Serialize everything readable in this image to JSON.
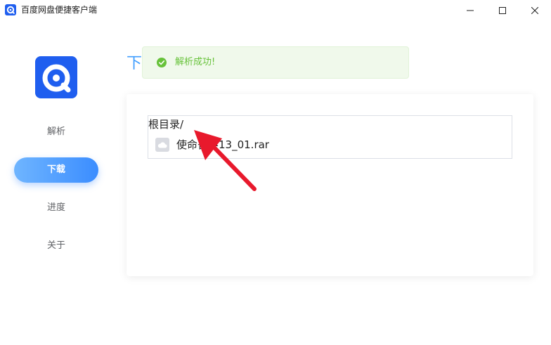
{
  "window": {
    "title": "百度网盘便捷客户端",
    "controls": {
      "minimize": "minimize",
      "maximize": "maximize",
      "close": "close"
    }
  },
  "sidebar": {
    "logo": "baidu-netdisk-logo",
    "items": [
      {
        "label": "解析",
        "active": false
      },
      {
        "label": "下载",
        "active": true
      },
      {
        "label": "进度",
        "active": false
      },
      {
        "label": "关于",
        "active": false
      }
    ]
  },
  "main": {
    "heading": "下"
  },
  "toast": {
    "type": "success",
    "message": "解析成功!",
    "color": "#67C23A"
  },
  "file_tree": {
    "root": "根目录/",
    "items": [
      {
        "name": "使命召唤13_01.rar",
        "icon": "cloud-file-icon"
      }
    ]
  },
  "colors": {
    "accent": "#409EFF",
    "logo": "#1F5EEF",
    "annotation_arrow": "#E8192C"
  }
}
